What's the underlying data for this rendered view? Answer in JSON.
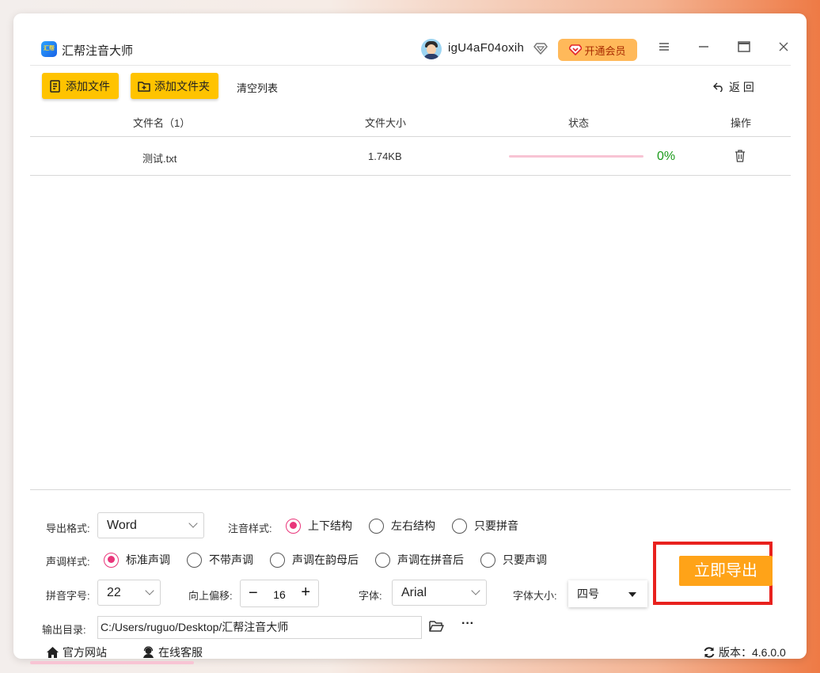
{
  "app": {
    "logo_text": "汇帮",
    "title": "汇帮注音大师",
    "username": "igU4aF04oxih",
    "vip_label": "开通会员"
  },
  "toolbar": {
    "add_file": "添加文件",
    "add_folder": "添加文件夹",
    "clear_list": "清空列表",
    "back": "返 回"
  },
  "table": {
    "headers": [
      "文件名（1）",
      "文件大小",
      "状态",
      "操作"
    ],
    "rows": [
      {
        "name": "测试.txt",
        "size": "1.74KB",
        "progress_percent": 0,
        "progress_text": "0%"
      }
    ]
  },
  "settings": {
    "export_format_label": "导出格式:",
    "export_format_value": "Word",
    "pinyin_style_label": "注音样式:",
    "pinyin_style_options": [
      "上下结构",
      "左右结构",
      "只要拼音"
    ],
    "pinyin_style_selected": 0,
    "tone_style_label": "声调样式:",
    "tone_style_options": [
      "标准声调",
      "不带声调",
      "声调在韵母后",
      "声调在拼音后",
      "只要声调"
    ],
    "tone_style_selected": 0,
    "pinyin_size_label": "拼音字号:",
    "pinyin_size_value": "22",
    "offset_label": "向上偏移:",
    "offset_minus": "−",
    "offset_value": "16",
    "offset_plus": "+",
    "font_label": "字体:",
    "font_value": "Arial",
    "font_size_label": "字体大小:",
    "font_size_value": "四号",
    "output_dir_label": "输出目录:",
    "output_dir_value": "C:/Users/ruguo/Desktop/汇帮注音大师",
    "more_label": "···",
    "export_button": "立即导出"
  },
  "footer": {
    "website": "官方网站",
    "support": "在线客服",
    "version": "版本：4.6.0.0"
  },
  "colors": {
    "accent_yellow": "#ffc300",
    "export_orange": "#ffa318",
    "radio_pink": "#e9357a",
    "progress_green": "#1a9a1a",
    "highlight_red": "#e8211e"
  }
}
